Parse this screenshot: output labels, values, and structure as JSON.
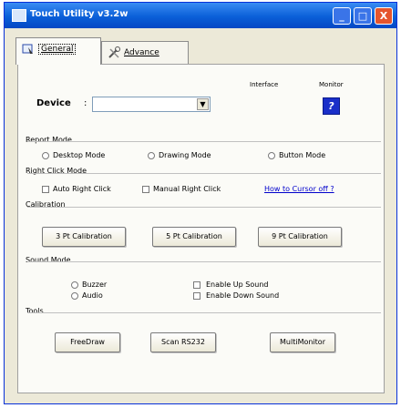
{
  "window": {
    "title": "Touch Utility v3.2w",
    "buttons": {
      "minimize": "_",
      "maximize": "□",
      "close": "X"
    }
  },
  "tabs": [
    {
      "label": "General",
      "active": true,
      "icon": "touch-tab-icon"
    },
    {
      "label": "Advance",
      "active": false,
      "icon": "tools-tab-icon"
    }
  ],
  "device": {
    "label": "Device",
    "value": "",
    "dropdown_arrow": "▼",
    "interface_label": "Interface",
    "monitor_label": "Monitor",
    "help": "?"
  },
  "report_mode": {
    "title": "Report Mode",
    "options": [
      "Desktop Mode",
      "Drawing Mode",
      "Button Mode"
    ]
  },
  "right_click_mode": {
    "title": "Right Click Mode",
    "options": [
      "Auto Right Click",
      "Manual Right Click"
    ],
    "link": "How to Cursor off ?"
  },
  "calibration": {
    "title": "Calibration",
    "buttons": [
      "3 Pt Calibration",
      "5 Pt Calibration",
      "9 Pt Calibration"
    ]
  },
  "sound_mode": {
    "title": "Sound Mode",
    "radios": [
      "Buzzer",
      "Audio"
    ],
    "checks": [
      "Enable Up Sound",
      "Enable Down Sound"
    ]
  },
  "tools": {
    "title": "Tools",
    "buttons": [
      "FreeDraw",
      "Scan RS232",
      "MultiMonitor"
    ]
  }
}
